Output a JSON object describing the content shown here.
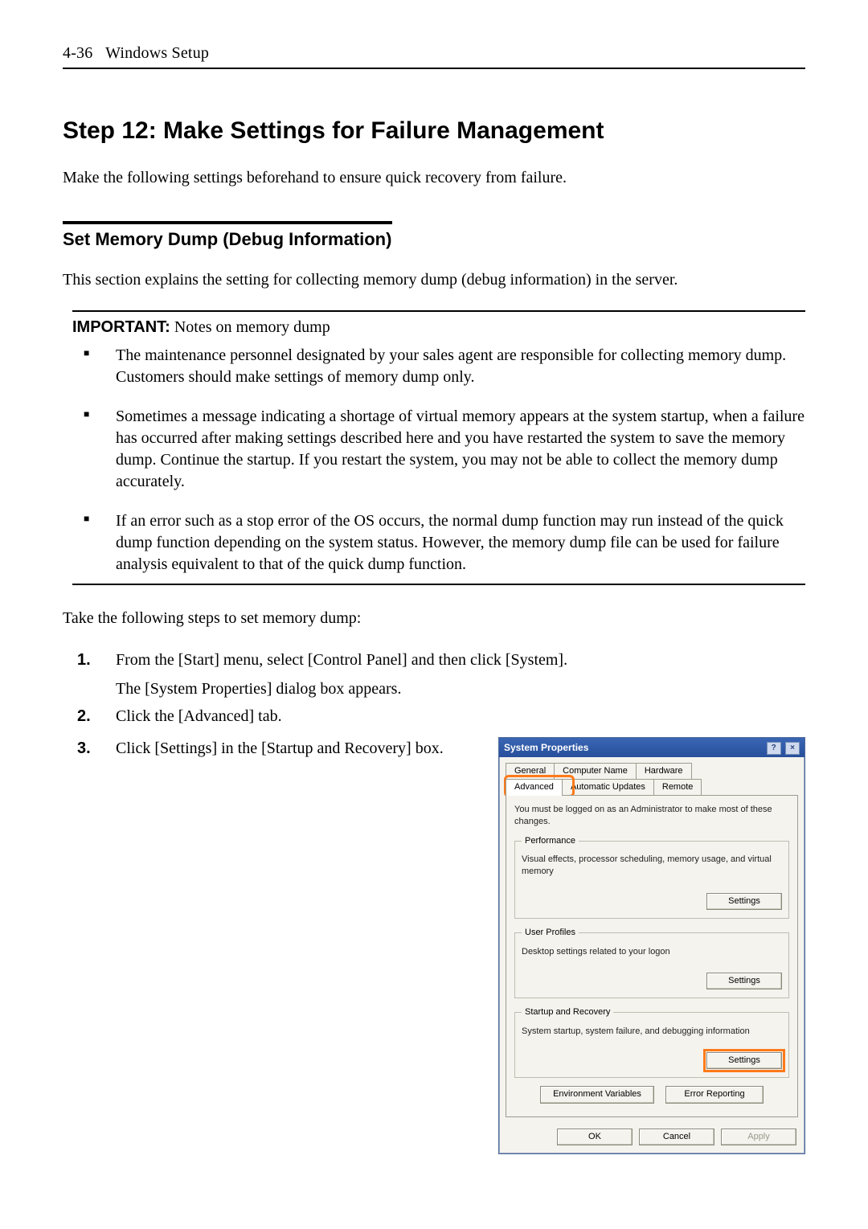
{
  "header": {
    "page_ref": "4-36",
    "section": "Windows Setup"
  },
  "title": "Step 12: Make Settings for Failure Management",
  "intro": "Make the following settings beforehand to ensure quick recovery from failure.",
  "subheading": "Set Memory Dump (Debug Information)",
  "sub_intro": "This section explains the setting for collecting memory dump (debug information) in the server.",
  "important": {
    "label": "IMPORTANT:",
    "tail": " Notes on memory dump",
    "bullets": [
      "The maintenance personnel designated by your sales agent are responsible for collecting memory dump. Customers should make settings of memory dump only.",
      "Sometimes a message indicating a shortage of virtual memory appears at the system startup, when a failure has occurred after making settings described here and you have restarted the system to save the memory dump. Continue the startup. If you restart the system, you may not be able to collect the memory dump accurately.",
      "If an error such as a stop error of the OS occurs, the normal dump function may run instead of the quick dump function depending on the system status. However, the memory dump file can be used for failure analysis equivalent to that of the quick dump function."
    ]
  },
  "steps_intro": "Take the following steps to set memory dump:",
  "steps": [
    {
      "text": "From the [Start] menu, select [Control Panel] and then click [System].",
      "sub": "The [System Properties] dialog box appears."
    },
    {
      "text": "Click the [Advanced] tab."
    },
    {
      "text": "Click [Settings] in the [Startup and Recovery] box."
    }
  ],
  "dialog": {
    "title": "System Properties",
    "help_icon": "?",
    "close_icon": "×",
    "tabs_row1": [
      "General",
      "Computer Name",
      "Hardware"
    ],
    "tabs_row2": [
      "Advanced",
      "Automatic Updates",
      "Remote"
    ],
    "active_tab": "Advanced",
    "admin_note": "You must be logged on as an Administrator to make most of these changes.",
    "groups": {
      "performance": {
        "legend": "Performance",
        "desc": "Visual effects, processor scheduling, memory usage, and virtual memory",
        "btn": "Settings"
      },
      "profiles": {
        "legend": "User Profiles",
        "desc": "Desktop settings related to your logon",
        "btn": "Settings"
      },
      "startup": {
        "legend": "Startup and Recovery",
        "desc": "System startup, system failure, and debugging information",
        "btn": "Settings"
      }
    },
    "env_btn": "Environment Variables",
    "error_btn": "Error Reporting",
    "footer": {
      "ok": "OK",
      "cancel": "Cancel",
      "apply": "Apply"
    }
  }
}
